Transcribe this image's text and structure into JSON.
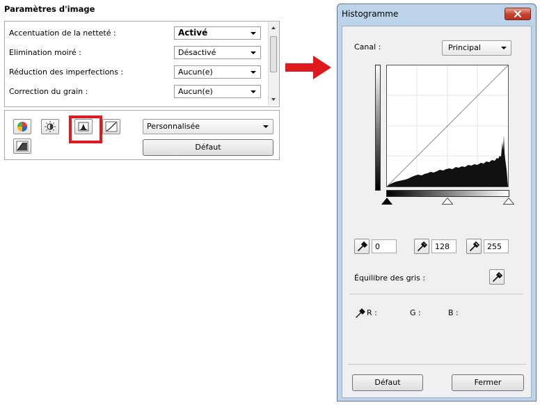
{
  "left_panel": {
    "title": "Paramètres d'image",
    "settings": [
      {
        "label": "Accentuation de la netteté :",
        "value": "Activé"
      },
      {
        "label": "Elimination moiré :",
        "value": "Désactivé"
      },
      {
        "label": "Réduction des imperfections :",
        "value": "Aucun(e)"
      },
      {
        "label": "Correction du grain :",
        "value": "Aucun(e)"
      }
    ],
    "preset": {
      "value": "Personnalisée"
    },
    "default_button": "Défaut",
    "tools": [
      "color-balance-icon",
      "brightness-contrast-icon",
      "histogram-icon",
      "tone-curve-icon",
      "threshold-icon"
    ],
    "highlight_color": "#e0191f"
  },
  "arrow": {
    "color": "#e0191f"
  },
  "histogram_dialog": {
    "title": "Histogramme",
    "canal_label": "Canal :",
    "canal_value": "Principal",
    "shadow_value": "0",
    "midtone_value": "128",
    "highlight_value": "255",
    "grey_balance_label": "Équilibre des gris :",
    "rgb": {
      "r": "R :",
      "g": "G :",
      "b": "B :"
    },
    "default_button": "Défaut",
    "close_button": "Fermer",
    "titlebar_color": "#bcd3e9"
  }
}
